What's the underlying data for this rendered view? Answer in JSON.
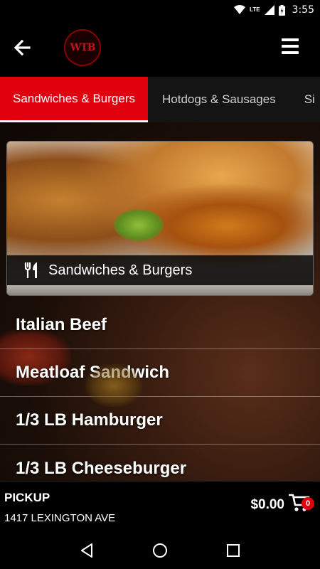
{
  "status_bar": {
    "network": "LTE",
    "time": "3:55",
    "icons": [
      "wifi-icon",
      "signal-icon",
      "battery-icon"
    ]
  },
  "app_bar": {
    "back_icon": "arrow-left-icon",
    "logo_text": "WTB",
    "menu_icon": "hamburger-menu-icon"
  },
  "tabs": [
    {
      "label": "Sandwiches & Burgers",
      "active": true
    },
    {
      "label": "Hotdogs & Sausages",
      "active": false
    },
    {
      "label": "Si",
      "active": false
    }
  ],
  "category_card": {
    "icon": "fork-knife-icon",
    "label": "Sandwiches & Burgers"
  },
  "menu_items": [
    {
      "label": "Italian Beef"
    },
    {
      "label": "Meatloaf Sandwich"
    },
    {
      "label": "1/3 LB Hamburger"
    },
    {
      "label": "1/3 LB Cheeseburger"
    }
  ],
  "footer": {
    "order_type": "PICKUP",
    "address": "1417 LEXINGTON AVE",
    "cart_total": "$0.00",
    "cart_count": "0",
    "cart_icon": "shopping-cart-icon"
  },
  "nav_bar": {
    "back": "nav-back-icon",
    "home": "nav-home-icon",
    "recents": "nav-recents-icon"
  },
  "colors": {
    "accent": "#e0000e",
    "background": "#000000",
    "tab_bar": "#141414"
  }
}
